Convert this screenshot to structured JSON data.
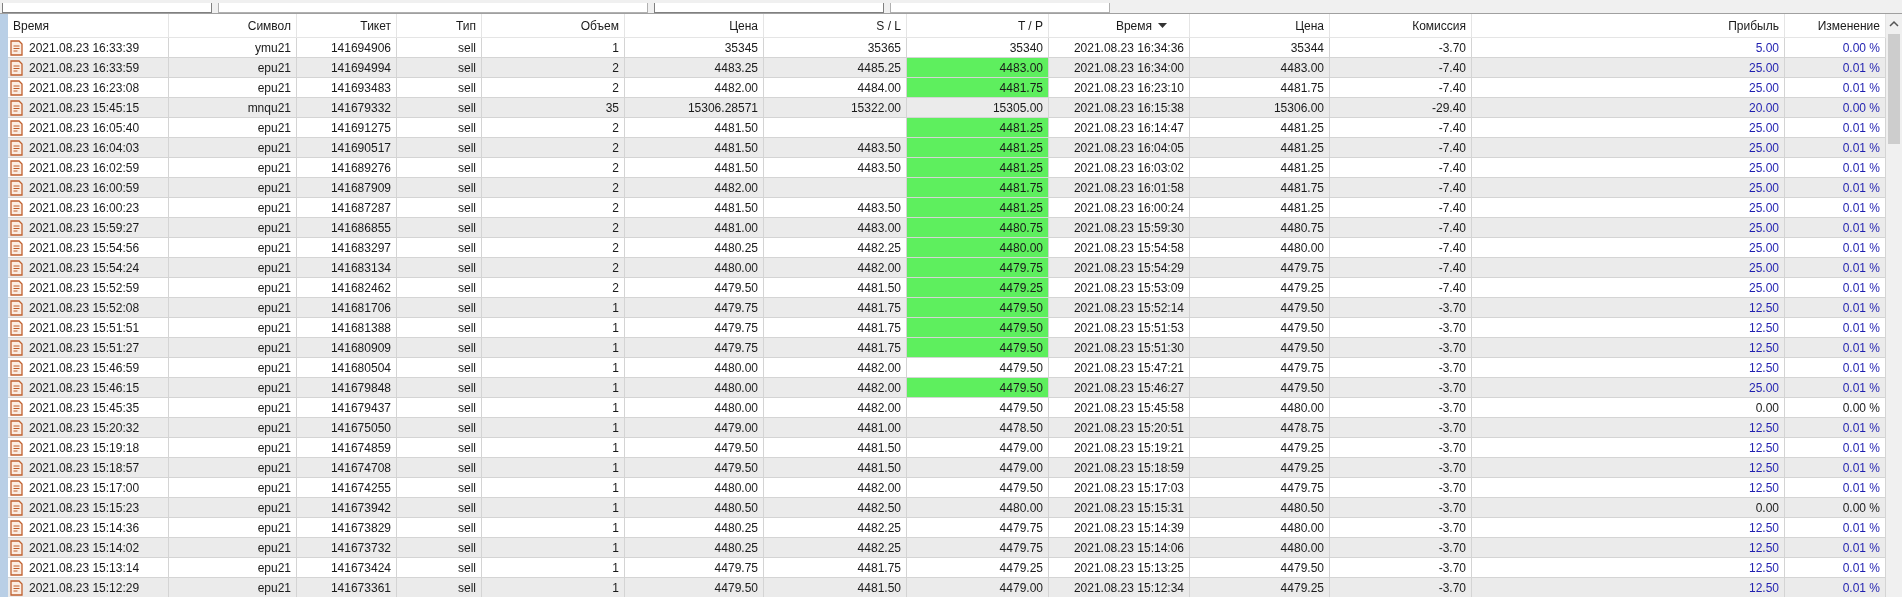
{
  "table": {
    "columns": [
      {
        "label": "Время",
        "sorted": false
      },
      {
        "label": "Символ",
        "sorted": false
      },
      {
        "label": "Тикет",
        "sorted": false
      },
      {
        "label": "Тип",
        "sorted": false
      },
      {
        "label": "Объем",
        "sorted": false
      },
      {
        "label": "Цена",
        "sorted": false
      },
      {
        "label": "S / L",
        "sorted": false
      },
      {
        "label": "T / P",
        "sorted": false
      },
      {
        "label": "Время",
        "sorted": true
      },
      {
        "label": "Цена",
        "sorted": false
      },
      {
        "label": "Комиссия",
        "sorted": false
      },
      {
        "label": "Прибыль",
        "sorted": false
      },
      {
        "label": "Изменение",
        "sorted": false
      }
    ],
    "rows": [
      {
        "open_time": "2021.08.23 16:33:39",
        "symbol": "ymu21",
        "ticket": "141694906",
        "type": "sell",
        "volume": "1",
        "price": "35345",
        "sl": "35365",
        "tp": "35340",
        "tp_highlighted": false,
        "close_time": "2021.08.23 16:34:36",
        "close_price": "35344",
        "commission": "-3.70",
        "profit": "5.00",
        "change": "0.00 %",
        "profit_positive": true
      },
      {
        "open_time": "2021.08.23 16:33:59",
        "symbol": "epu21",
        "ticket": "141694994",
        "type": "sell",
        "volume": "2",
        "price": "4483.25",
        "sl": "4485.25",
        "tp": "4483.00",
        "tp_highlighted": true,
        "close_time": "2021.08.23 16:34:00",
        "close_price": "4483.00",
        "commission": "-7.40",
        "profit": "25.00",
        "change": "0.01 %",
        "profit_positive": true
      },
      {
        "open_time": "2021.08.23 16:23:08",
        "symbol": "epu21",
        "ticket": "141693483",
        "type": "sell",
        "volume": "2",
        "price": "4482.00",
        "sl": "4484.00",
        "tp": "4481.75",
        "tp_highlighted": true,
        "close_time": "2021.08.23 16:23:10",
        "close_price": "4481.75",
        "commission": "-7.40",
        "profit": "25.00",
        "change": "0.01 %",
        "profit_positive": true
      },
      {
        "open_time": "2021.08.23 15:45:15",
        "symbol": "mnqu21",
        "ticket": "141679332",
        "type": "sell",
        "volume": "35",
        "price": "15306.28571",
        "sl": "15322.00",
        "tp": "15305.00",
        "tp_highlighted": false,
        "close_time": "2021.08.23 16:15:38",
        "close_price": "15306.00",
        "commission": "-29.40",
        "profit": "20.00",
        "change": "0.00 %",
        "profit_positive": true
      },
      {
        "open_time": "2021.08.23 16:05:40",
        "symbol": "epu21",
        "ticket": "141691275",
        "type": "sell",
        "volume": "2",
        "price": "4481.50",
        "tp": "4481.25",
        "tp_highlighted": true,
        "close_time": "2021.08.23 16:14:47",
        "close_price": "4481.25",
        "commission": "-7.40",
        "profit": "25.00",
        "change": "0.01 %",
        "profit_positive": true
      },
      {
        "open_time": "2021.08.23 16:04:03",
        "symbol": "epu21",
        "ticket": "141690517",
        "type": "sell",
        "volume": "2",
        "price": "4481.50",
        "sl": "4483.50",
        "tp": "4481.25",
        "tp_highlighted": true,
        "close_time": "2021.08.23 16:04:05",
        "close_price": "4481.25",
        "commission": "-7.40",
        "profit": "25.00",
        "change": "0.01 %",
        "profit_positive": true
      },
      {
        "open_time": "2021.08.23 16:02:59",
        "symbol": "epu21",
        "ticket": "141689276",
        "type": "sell",
        "volume": "2",
        "price": "4481.50",
        "sl": "4483.50",
        "tp": "4481.25",
        "tp_highlighted": true,
        "close_time": "2021.08.23 16:03:02",
        "close_price": "4481.25",
        "commission": "-7.40",
        "profit": "25.00",
        "change": "0.01 %",
        "profit_positive": true
      },
      {
        "open_time": "2021.08.23 16:00:59",
        "symbol": "epu21",
        "ticket": "141687909",
        "type": "sell",
        "volume": "2",
        "price": "4482.00",
        "tp": "4481.75",
        "tp_highlighted": true,
        "close_time": "2021.08.23 16:01:58",
        "close_price": "4481.75",
        "commission": "-7.40",
        "profit": "25.00",
        "change": "0.01 %",
        "profit_positive": true
      },
      {
        "open_time": "2021.08.23 16:00:23",
        "symbol": "epu21",
        "ticket": "141687287",
        "type": "sell",
        "volume": "2",
        "price": "4481.50",
        "sl": "4483.50",
        "tp": "4481.25",
        "tp_highlighted": true,
        "close_time": "2021.08.23 16:00:24",
        "close_price": "4481.25",
        "commission": "-7.40",
        "profit": "25.00",
        "change": "0.01 %",
        "profit_positive": true
      },
      {
        "open_time": "2021.08.23 15:59:27",
        "symbol": "epu21",
        "ticket": "141686855",
        "type": "sell",
        "volume": "2",
        "price": "4481.00",
        "sl": "4483.00",
        "tp": "4480.75",
        "tp_highlighted": true,
        "close_time": "2021.08.23 15:59:30",
        "close_price": "4480.75",
        "commission": "-7.40",
        "profit": "25.00",
        "change": "0.01 %",
        "profit_positive": true
      },
      {
        "open_time": "2021.08.23 15:54:56",
        "symbol": "epu21",
        "ticket": "141683297",
        "type": "sell",
        "volume": "2",
        "price": "4480.25",
        "sl": "4482.25",
        "tp": "4480.00",
        "tp_highlighted": true,
        "close_time": "2021.08.23 15:54:58",
        "close_price": "4480.00",
        "commission": "-7.40",
        "profit": "25.00",
        "change": "0.01 %",
        "profit_positive": true
      },
      {
        "open_time": "2021.08.23 15:54:24",
        "symbol": "epu21",
        "ticket": "141683134",
        "type": "sell",
        "volume": "2",
        "price": "4480.00",
        "sl": "4482.00",
        "tp": "4479.75",
        "tp_highlighted": true,
        "close_time": "2021.08.23 15:54:29",
        "close_price": "4479.75",
        "commission": "-7.40",
        "profit": "25.00",
        "change": "0.01 %",
        "profit_positive": true
      },
      {
        "open_time": "2021.08.23 15:52:59",
        "symbol": "epu21",
        "ticket": "141682462",
        "type": "sell",
        "volume": "2",
        "price": "4479.50",
        "sl": "4481.50",
        "tp": "4479.25",
        "tp_highlighted": true,
        "close_time": "2021.08.23 15:53:09",
        "close_price": "4479.25",
        "commission": "-7.40",
        "profit": "25.00",
        "change": "0.01 %",
        "profit_positive": true
      },
      {
        "open_time": "2021.08.23 15:52:08",
        "symbol": "epu21",
        "ticket": "141681706",
        "type": "sell",
        "volume": "1",
        "price": "4479.75",
        "sl": "4481.75",
        "tp": "4479.50",
        "tp_highlighted": true,
        "close_time": "2021.08.23 15:52:14",
        "close_price": "4479.50",
        "commission": "-3.70",
        "profit": "12.50",
        "change": "0.01 %",
        "profit_positive": true
      },
      {
        "open_time": "2021.08.23 15:51:51",
        "symbol": "epu21",
        "ticket": "141681388",
        "type": "sell",
        "volume": "1",
        "price": "4479.75",
        "sl": "4481.75",
        "tp": "4479.50",
        "tp_highlighted": true,
        "close_time": "2021.08.23 15:51:53",
        "close_price": "4479.50",
        "commission": "-3.70",
        "profit": "12.50",
        "change": "0.01 %",
        "profit_positive": true
      },
      {
        "open_time": "2021.08.23 15:51:27",
        "symbol": "epu21",
        "ticket": "141680909",
        "type": "sell",
        "volume": "1",
        "price": "4479.75",
        "sl": "4481.75",
        "tp": "4479.50",
        "tp_highlighted": true,
        "close_time": "2021.08.23 15:51:30",
        "close_price": "4479.50",
        "commission": "-3.70",
        "profit": "12.50",
        "change": "0.01 %",
        "profit_positive": true
      },
      {
        "open_time": "2021.08.23 15:46:59",
        "symbol": "epu21",
        "ticket": "141680504",
        "type": "sell",
        "volume": "1",
        "price": "4480.00",
        "sl": "4482.00",
        "tp": "4479.50",
        "tp_highlighted": false,
        "close_time": "2021.08.23 15:47:21",
        "close_price": "4479.75",
        "commission": "-3.70",
        "profit": "12.50",
        "change": "0.01 %",
        "profit_positive": true
      },
      {
        "open_time": "2021.08.23 15:46:15",
        "symbol": "epu21",
        "ticket": "141679848",
        "type": "sell",
        "volume": "1",
        "price": "4480.00",
        "sl": "4482.00",
        "tp": "4479.50",
        "tp_highlighted": true,
        "close_time": "2021.08.23 15:46:27",
        "close_price": "4479.50",
        "commission": "-3.70",
        "profit": "25.00",
        "change": "0.01 %",
        "profit_positive": true
      },
      {
        "open_time": "2021.08.23 15:45:35",
        "symbol": "epu21",
        "ticket": "141679437",
        "type": "sell",
        "volume": "1",
        "price": "4480.00",
        "sl": "4482.00",
        "tp": "4479.50",
        "tp_highlighted": false,
        "close_time": "2021.08.23 15:45:58",
        "close_price": "4480.00",
        "commission": "-3.70",
        "profit": "0.00",
        "change": "0.00 %",
        "profit_positive": false
      },
      {
        "open_time": "2021.08.23 15:20:32",
        "symbol": "epu21",
        "ticket": "141675050",
        "type": "sell",
        "volume": "1",
        "price": "4479.00",
        "sl": "4481.00",
        "tp": "4478.50",
        "tp_highlighted": false,
        "close_time": "2021.08.23 15:20:51",
        "close_price": "4478.75",
        "commission": "-3.70",
        "profit": "12.50",
        "change": "0.01 %",
        "profit_positive": true
      },
      {
        "open_time": "2021.08.23 15:19:18",
        "symbol": "epu21",
        "ticket": "141674859",
        "type": "sell",
        "volume": "1",
        "price": "4479.50",
        "sl": "4481.50",
        "tp": "4479.00",
        "tp_highlighted": false,
        "close_time": "2021.08.23 15:19:21",
        "close_price": "4479.25",
        "commission": "-3.70",
        "profit": "12.50",
        "change": "0.01 %",
        "profit_positive": true
      },
      {
        "open_time": "2021.08.23 15:18:57",
        "symbol": "epu21",
        "ticket": "141674708",
        "type": "sell",
        "volume": "1",
        "price": "4479.50",
        "sl": "4481.50",
        "tp": "4479.00",
        "tp_highlighted": false,
        "close_time": "2021.08.23 15:18:59",
        "close_price": "4479.25",
        "commission": "-3.70",
        "profit": "12.50",
        "change": "0.01 %",
        "profit_positive": true
      },
      {
        "open_time": "2021.08.23 15:17:00",
        "symbol": "epu21",
        "ticket": "141674255",
        "type": "sell",
        "volume": "1",
        "price": "4480.00",
        "sl": "4482.00",
        "tp": "4479.50",
        "tp_highlighted": false,
        "close_time": "2021.08.23 15:17:03",
        "close_price": "4479.75",
        "commission": "-3.70",
        "profit": "12.50",
        "change": "0.01 %",
        "profit_positive": true
      },
      {
        "open_time": "2021.08.23 15:15:23",
        "symbol": "epu21",
        "ticket": "141673942",
        "type": "sell",
        "volume": "1",
        "price": "4480.50",
        "sl": "4482.50",
        "tp": "4480.00",
        "tp_highlighted": false,
        "close_time": "2021.08.23 15:15:31",
        "close_price": "4480.50",
        "commission": "-3.70",
        "profit": "0.00",
        "change": "0.00 %",
        "profit_positive": false
      },
      {
        "open_time": "2021.08.23 15:14:36",
        "symbol": "epu21",
        "ticket": "141673829",
        "type": "sell",
        "volume": "1",
        "price": "4480.25",
        "sl": "4482.25",
        "tp": "4479.75",
        "tp_highlighted": false,
        "close_time": "2021.08.23 15:14:39",
        "close_price": "4480.00",
        "commission": "-3.70",
        "profit": "12.50",
        "change": "0.01 %",
        "profit_positive": true
      },
      {
        "open_time": "2021.08.23 15:14:02",
        "symbol": "epu21",
        "ticket": "141673732",
        "type": "sell",
        "volume": "1",
        "price": "4480.25",
        "sl": "4482.25",
        "tp": "4479.75",
        "tp_highlighted": false,
        "close_time": "2021.08.23 15:14:06",
        "close_price": "4480.00",
        "commission": "-3.70",
        "profit": "12.50",
        "change": "0.01 %",
        "profit_positive": true
      },
      {
        "open_time": "2021.08.23 15:13:14",
        "symbol": "epu21",
        "ticket": "141673424",
        "type": "sell",
        "volume": "1",
        "price": "4479.75",
        "sl": "4481.75",
        "tp": "4479.25",
        "tp_highlighted": false,
        "close_time": "2021.08.23 15:13:25",
        "close_price": "4479.50",
        "commission": "-3.70",
        "profit": "12.50",
        "change": "0.01 %",
        "profit_positive": true
      },
      {
        "open_time": "2021.08.23 15:12:29",
        "symbol": "epu21",
        "ticket": "141673361",
        "type": "sell",
        "volume": "1",
        "price": "4479.50",
        "sl": "4481.50",
        "tp": "4479.00",
        "tp_highlighted": false,
        "close_time": "2021.08.23 15:12:34",
        "close_price": "4479.25",
        "commission": "-3.70",
        "profit": "12.50",
        "change": "0.01 %",
        "profit_positive": true
      }
    ]
  }
}
